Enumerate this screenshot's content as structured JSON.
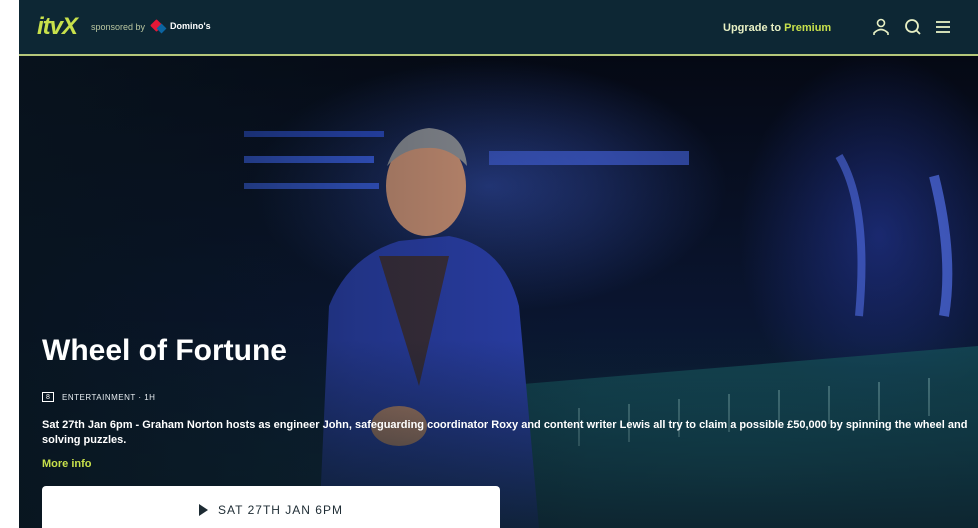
{
  "header": {
    "logo": "itvX",
    "sponsor_text": "sponsored by",
    "sponsor_brand": "Domino's",
    "upgrade_prefix": "Upgrade to",
    "upgrade_highlight": "Premium",
    "icons": [
      "account-icon",
      "search-icon",
      "menu-icon"
    ]
  },
  "hero": {
    "title": "Wheel of Fortune",
    "rating": "8",
    "genre": "ENTERTAINMENT · 1H",
    "description": "Sat 27th Jan 6pm - Graham Norton hosts as engineer John, safeguarding coordinator Roxy and content writer Lewis all try to claim a possible £50,000 by spinning the wheel and solving puzzles.",
    "more_info": "More info",
    "cta_label": "SAT 27TH JAN 6PM"
  },
  "colors": {
    "accent": "#c7e04b",
    "header_bg": "#0d2734",
    "header_border": "#b5c77a"
  }
}
